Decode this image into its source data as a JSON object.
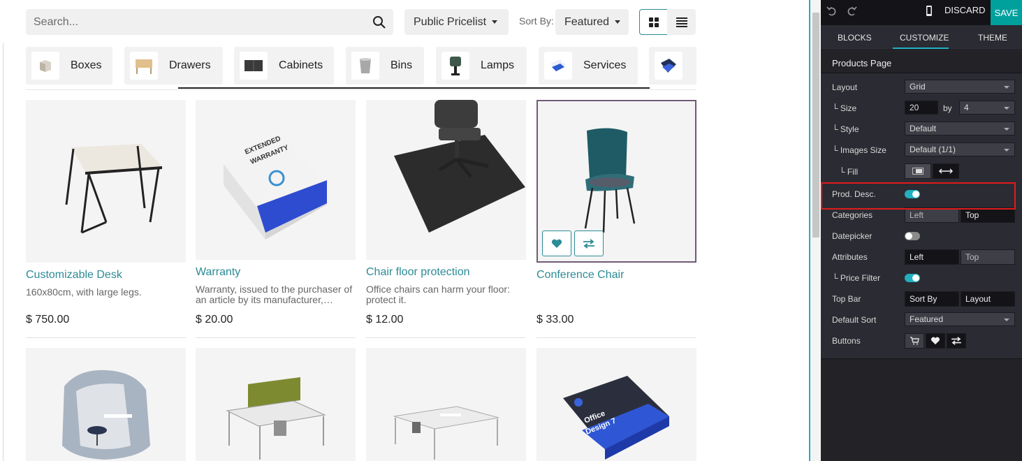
{
  "search": {
    "placeholder": "Search..."
  },
  "pricelist": {
    "label": "Public Pricelist"
  },
  "sort": {
    "label": "Sort By:",
    "value": "Featured"
  },
  "categories": [
    {
      "label": "Boxes"
    },
    {
      "label": "Drawers"
    },
    {
      "label": "Cabinets"
    },
    {
      "label": "Bins"
    },
    {
      "label": "Lamps"
    },
    {
      "label": "Services"
    }
  ],
  "products": [
    {
      "name": "Customizable Desk",
      "desc": "160x80cm, with large legs.",
      "price": "$ 750.00"
    },
    {
      "name": "Warranty",
      "desc": "Warranty, issued to the purchaser of an article by its manufacturer,…",
      "price": "$ 20.00"
    },
    {
      "name": "Chair floor protection",
      "desc": "Office chairs can harm your floor: protect it.",
      "price": "$ 12.00"
    },
    {
      "name": "Conference Chair",
      "desc": "",
      "price": "$ 33.00"
    }
  ],
  "editor": {
    "discard": "DISCARD",
    "save": "SAVE",
    "tabs": {
      "blocks": "BLOCKS",
      "customize": "CUSTOMIZE",
      "theme": "THEME"
    },
    "section_title": "Products Page",
    "layout": {
      "label": "Layout",
      "value": "Grid"
    },
    "size": {
      "label": "└ Size",
      "value": "20",
      "by": "by",
      "per_row": "4"
    },
    "style": {
      "label": "└ Style",
      "value": "Default"
    },
    "images_size": {
      "label": "└ Images Size",
      "value": "Default (1/1)"
    },
    "fill": {
      "label": "└ Fill"
    },
    "prod_desc": {
      "label": "Prod. Desc.",
      "enabled": true
    },
    "categories": {
      "label": "Categories",
      "options": [
        "Left",
        "Top"
      ]
    },
    "datepicker": {
      "label": "Datepicker",
      "enabled": false
    },
    "attributes": {
      "label": "Attributes",
      "options": [
        "Left",
        "Top"
      ]
    },
    "price_filter": {
      "label": "└ Price Filter",
      "enabled": true
    },
    "top_bar": {
      "label": "Top Bar",
      "options": [
        "Sort By",
        "Layout"
      ]
    },
    "default_sort": {
      "label": "Default Sort",
      "value": "Featured"
    },
    "buttons": {
      "label": "Buttons"
    }
  },
  "colors": {
    "accent": "#20b0c0",
    "link": "#2c8b95",
    "save": "#00a09d",
    "highlight": "#e01b1b",
    "panel": "#2b2b33"
  }
}
